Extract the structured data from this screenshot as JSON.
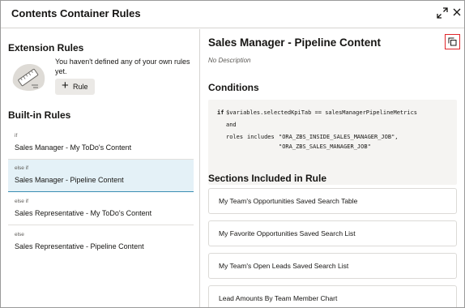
{
  "dialog": {
    "title": "Contents Container Rules",
    "expand_icon": "expand-arrows-icon",
    "close_icon": "close-icon"
  },
  "left": {
    "extension_rules": {
      "heading": "Extension Rules",
      "empty_message": "You haven't defined any of your own rules yet.",
      "add_rule_label": "Rule",
      "illustration_icon": "rules-illustration-icon"
    },
    "builtin_rules": {
      "heading": "Built-in Rules",
      "items": [
        {
          "condition": "if",
          "name": "Sales Manager - My ToDo's Content"
        },
        {
          "condition": "else if",
          "name": "Sales Manager - Pipeline Content"
        },
        {
          "condition": "else if",
          "name": "Sales Representative - My ToDo's Content"
        },
        {
          "condition": "else",
          "name": "Sales Representative - Pipeline Content"
        }
      ],
      "selected_index": 1
    }
  },
  "detail": {
    "title": "Sales Manager - Pipeline Content",
    "description": "No Description",
    "copy_icon": "copy-icon",
    "conditions_heading": "Conditions",
    "code": {
      "line1_kw": "if",
      "line1_expr": "$variables.selectedKpiTab == salesManagerPipelineMetrics",
      "line2": "and",
      "line3_field": "roles",
      "line3_op": "includes",
      "line3_val1": "\"ORA_ZBS_INSIDE_SALES_MANAGER_JOB\",",
      "line4_val2": "\"ORA_ZBS_SALES_MANAGER_JOB\""
    },
    "sections_heading": "Sections Included in Rule",
    "sections": [
      "My Team's Opportunities Saved Search Table",
      "My Favorite Opportunities Saved Search List",
      "My Team's Open Leads Saved Search List",
      "Lead Amounts By Team Member Chart"
    ]
  },
  "colors": {
    "selected_bg": "#e4f1f7",
    "selected_border": "#3b8eb3",
    "highlight_red": "#e0262a",
    "code_bg": "#f5f4f2"
  }
}
